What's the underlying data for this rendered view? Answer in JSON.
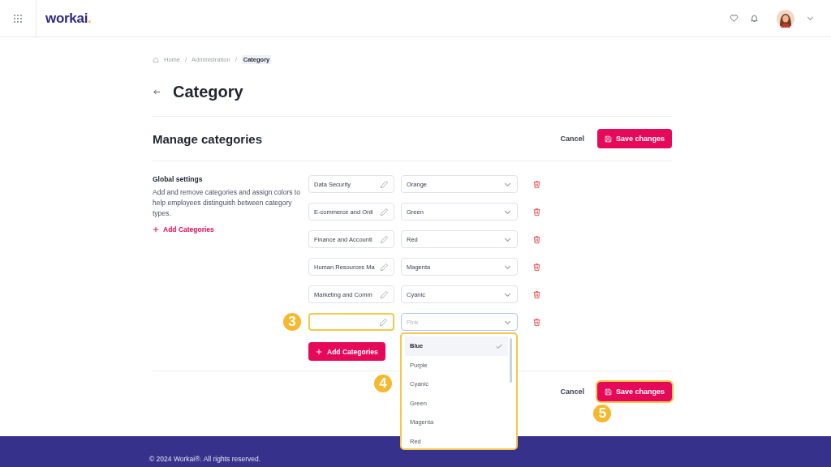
{
  "header": {
    "logo_text": "workai",
    "logo_dot": "."
  },
  "breadcrumb": [
    {
      "label": "Home",
      "current": false
    },
    {
      "label": "Administration",
      "current": false
    },
    {
      "label": "Category",
      "current": true
    }
  ],
  "breadcrumb_separator": "/",
  "title": "Category",
  "section": {
    "title": "Manage categories",
    "cancel": "Cancel",
    "save": "Save changes"
  },
  "settings": {
    "heading": "Global settings",
    "description": "Add and remove categories and assign colors to help employees distinguish between category types.",
    "add_link": "Add Categories"
  },
  "categories": [
    {
      "name": "Data Security",
      "value": "Orange",
      "highlighted": false,
      "focused": false
    },
    {
      "name": "E-commerce and Onli",
      "value": "Green",
      "highlighted": false,
      "focused": false
    },
    {
      "name": "Finance and Accounti",
      "value": "Red",
      "highlighted": false,
      "focused": false
    },
    {
      "name": "Human Resources Ma",
      "value": "Magenta",
      "highlighted": false,
      "focused": false
    },
    {
      "name": "Marketing and Comm",
      "value": "Cyanic",
      "highlighted": false,
      "focused": false
    },
    {
      "value_placeholder": "Pink",
      "highlighted": true,
      "focused": true,
      "step": "3"
    }
  ],
  "dropdown": {
    "step": "4",
    "options": [
      {
        "label": "Blue",
        "selected": true
      },
      {
        "label": "Purple",
        "selected": false
      },
      {
        "label": "Cyanic",
        "selected": false
      },
      {
        "label": "Green",
        "selected": false
      },
      {
        "label": "Magenta",
        "selected": false
      },
      {
        "label": "Red",
        "selected": false
      }
    ]
  },
  "add_button": "Add Categories",
  "bottom_actions": {
    "cancel": "Cancel",
    "save": "Save changes",
    "save_highlighted": true,
    "step": "5"
  },
  "footer": "© 2024 Workai®. All rights reserved."
}
